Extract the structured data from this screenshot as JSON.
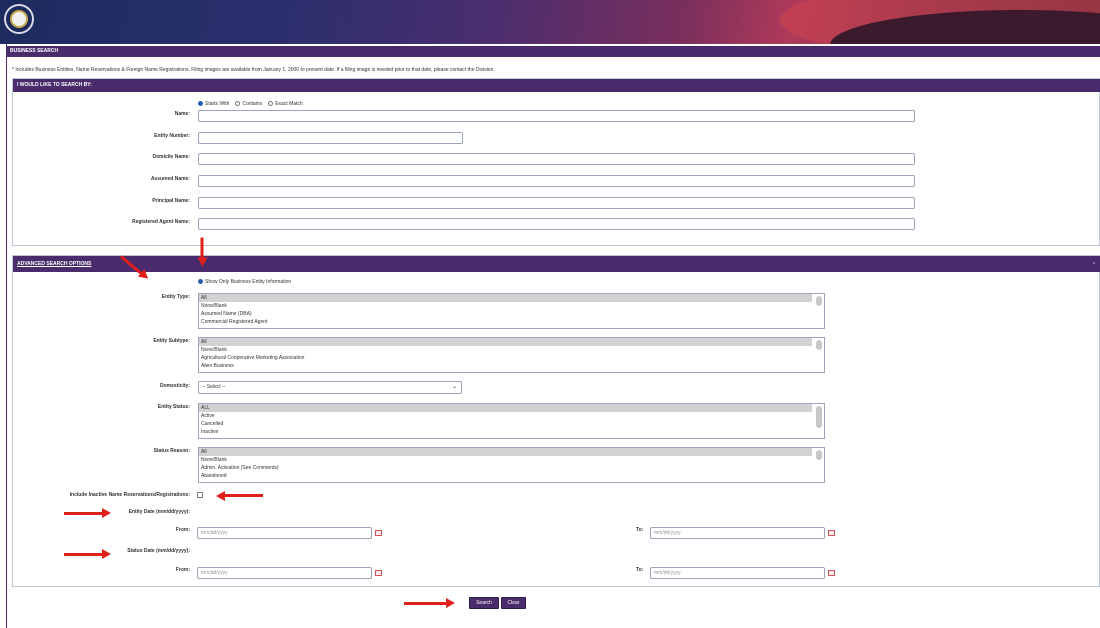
{
  "header": {
    "seal": "state-seal"
  },
  "section_bar": {
    "title": "BUSINESS SEARCH"
  },
  "notice": "* Includes Business Entities, Name Reservations & Foreign Name Registrations. Filing images are available from January 1, 2000 to present date. If a filing image is needed prior to that date, please contact the Division.",
  "search_by": {
    "title": "I WOULD LIKE TO SEARCH BY:",
    "match_options": [
      "Starts With",
      "Contains",
      "Exact Match"
    ],
    "selected_match": "Starts With",
    "fields": {
      "name": "Name:",
      "entity_number": "Entity Number:",
      "domicile_name": "Domicile Name:",
      "assumed_name": "Assumed Name:",
      "principal_name": "Principal Name:",
      "registered_agent_name": "Registered Agent Name:"
    }
  },
  "advanced": {
    "title": "ADVANCED SEARCH OPTIONS",
    "collapse": "-",
    "show_only": "Show Only Business Entity Information",
    "entity_type": {
      "label": "Entity Type:",
      "options": [
        "All",
        "None/Blank",
        "Assumed Name (DBA)",
        "Commercial Registered Agent"
      ]
    },
    "entity_subtype": {
      "label": "Entity Subtype:",
      "options": [
        "All",
        "None/Blank",
        "Agricultural Cooperative Marketing Association",
        "Alien Business"
      ]
    },
    "domesticity": {
      "label": "Domesticity:",
      "value": "-- Select --"
    },
    "entity_status": {
      "label": "Entity Status:",
      "options": [
        "ALL",
        "Active",
        "Cancelled",
        "Inactive"
      ]
    },
    "status_reason": {
      "label": "Status Reason:",
      "options": [
        "All",
        "None/Blank",
        "Admin. Activation (See Comments)",
        "Abandoned"
      ]
    },
    "include_inactive": "Include Inactive Name Reservations/Registrations:",
    "entity_date": {
      "label": "Entity Date (mm/dd/yyyy):",
      "from_label": "From:",
      "to_label": "To:",
      "placeholder": "mm/dd/yyyy"
    },
    "status_date": {
      "label": "Status Date (mm/dd/yyyy):",
      "from_label": "From:",
      "to_label": "To:",
      "placeholder": "mm/dd/yyyy"
    }
  },
  "buttons": {
    "search": "Search",
    "clear": "Clear"
  },
  "colors": {
    "primary": "#4a2c6d",
    "annotation_arrow": "#e0201a"
  }
}
